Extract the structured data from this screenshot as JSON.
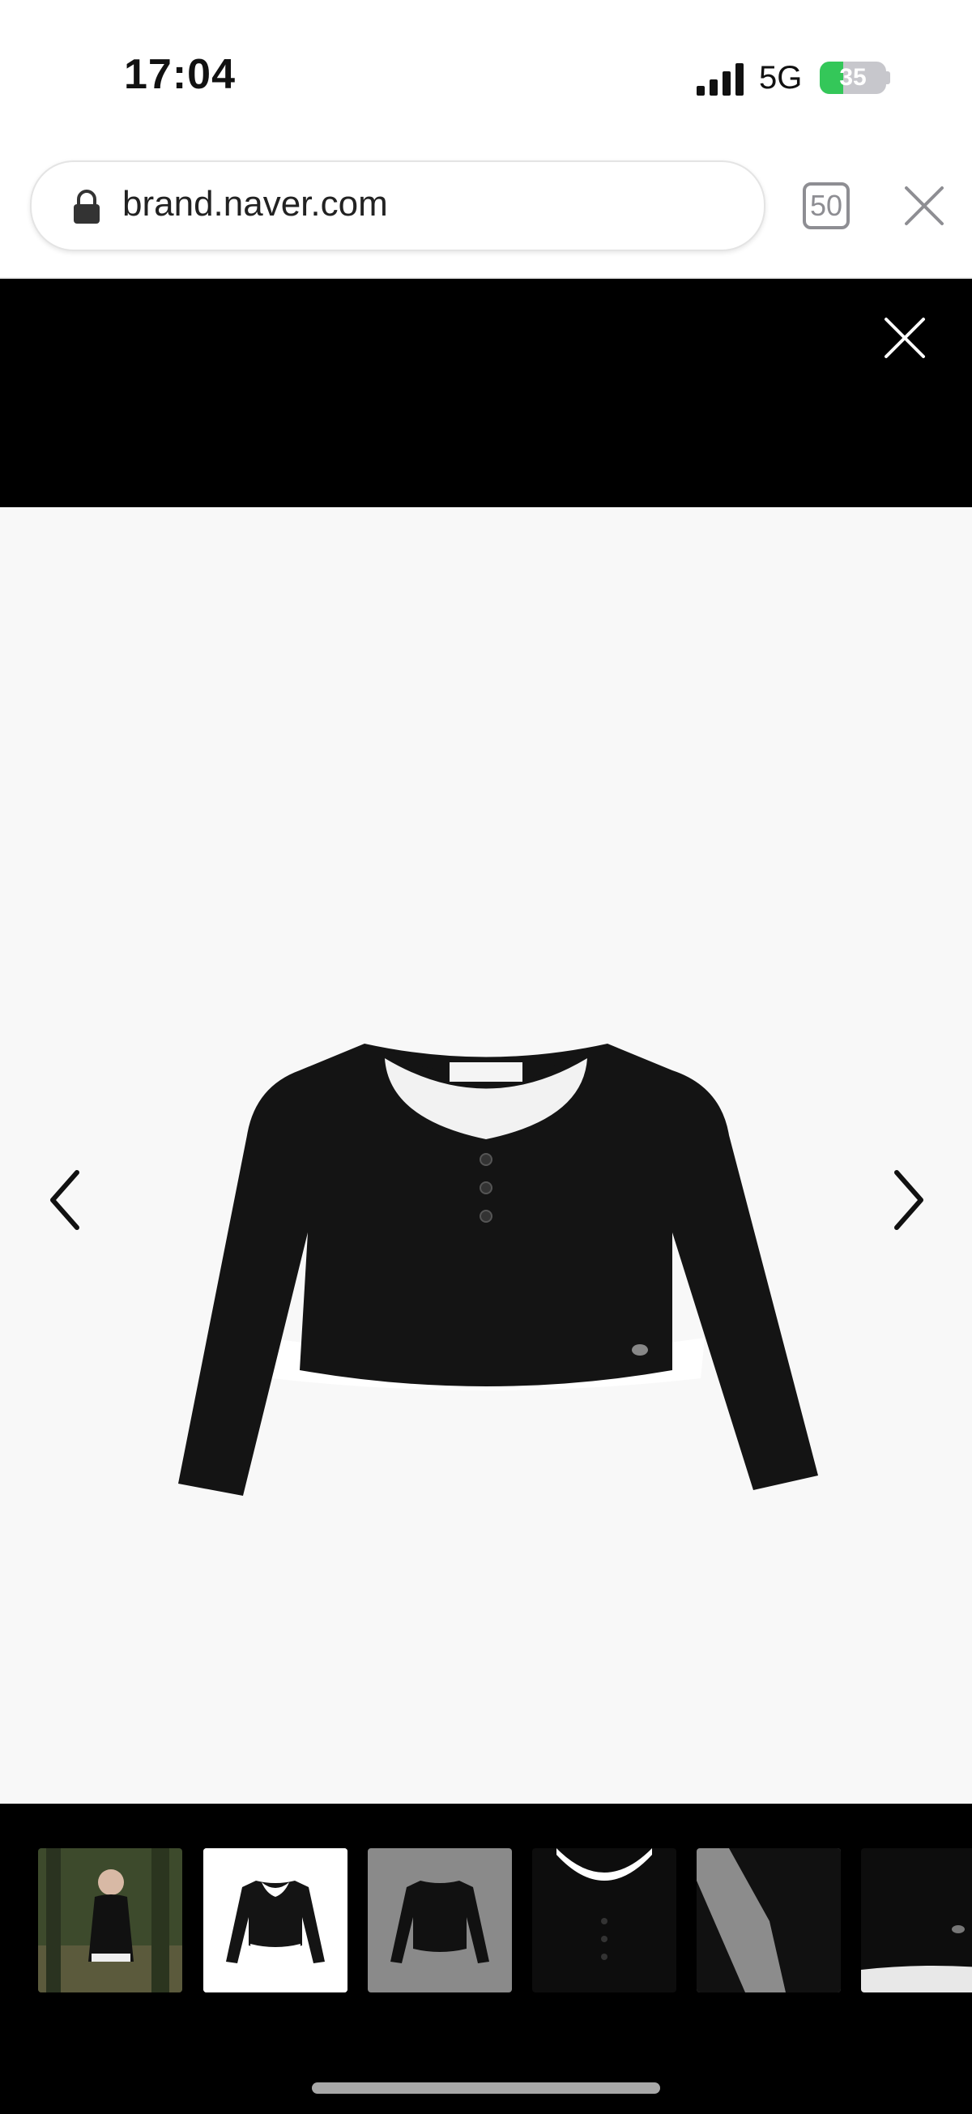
{
  "status_bar": {
    "time": "17:04",
    "network": "5G",
    "battery_percent": "35",
    "battery_level": 0.35
  },
  "browser": {
    "url": "brand.naver.com",
    "tab_count": "50"
  },
  "viewer": {
    "background": "#000000",
    "image_background": "#f8f8f8",
    "thumbnail_count": 6,
    "selected_thumbnail_index": 1
  },
  "icons": {
    "lock": "lock-icon",
    "close": "close-icon",
    "prev": "chevron-left-icon",
    "next": "chevron-right-icon"
  }
}
